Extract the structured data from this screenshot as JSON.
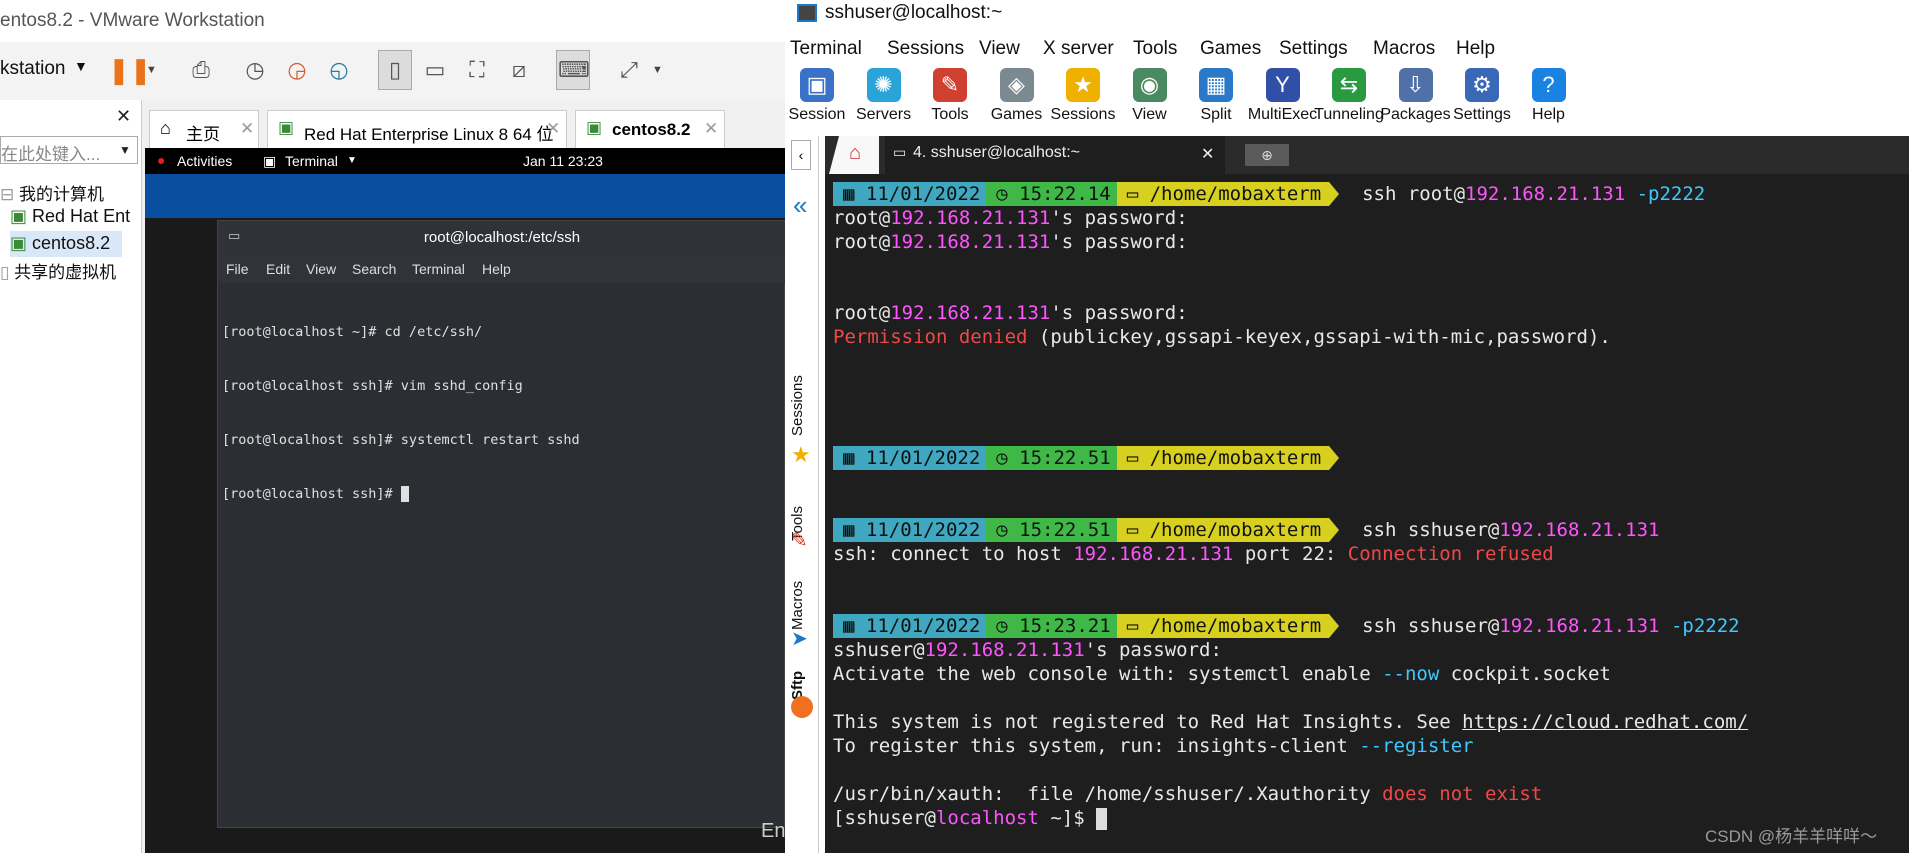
{
  "vmware": {
    "title": "entos8.2 - VMware Workstation",
    "toolbar_label": "kstation",
    "library": {
      "search_placeholder": "在此处键入...",
      "items": [
        "我的计算机",
        "Red Hat Ent",
        "centos8.2",
        "共享的虚拟机"
      ]
    },
    "tabs": [
      "主页",
      "Red Hat Enterprise Linux 8 64 位",
      "centos8.2"
    ],
    "gnome": {
      "activities": "Activities",
      "app": "Terminal",
      "clock": "Jan 11  23:23"
    },
    "guest_terminal": {
      "title": "root@localhost:/etc/ssh",
      "menu": [
        "File",
        "Edit",
        "View",
        "Search",
        "Terminal",
        "Help"
      ],
      "lines": [
        "[root@localhost ~]# cd /etc/ssh/",
        "[root@localhost ssh]# vim sshd_config",
        "[root@localhost ssh]# systemctl restart sshd",
        "[root@localhost ssh]# "
      ]
    },
    "corner_text": "En"
  },
  "mobaxterm": {
    "title": "sshuser@localhost:~",
    "menu": [
      "Terminal",
      "Sessions",
      "View",
      "X server",
      "Tools",
      "Games",
      "Settings",
      "Macros",
      "Help"
    ],
    "tools": [
      {
        "label": "Session",
        "icon": "session-icon",
        "color": "#3a72c8"
      },
      {
        "label": "Servers",
        "icon": "servers-icon",
        "color": "#2aa4d8"
      },
      {
        "label": "Tools",
        "icon": "tools-icon",
        "color": "#d04030"
      },
      {
        "label": "Games",
        "icon": "games-icon",
        "color": "#7a8a90"
      },
      {
        "label": "Sessions",
        "icon": "star-icon",
        "color": "#f0b000"
      },
      {
        "label": "View",
        "icon": "view-icon",
        "color": "#4a8a60"
      },
      {
        "label": "Split",
        "icon": "split-icon",
        "color": "#2a78c8"
      },
      {
        "label": "MultiExec",
        "icon": "multiexec-icon",
        "color": "#3050a8"
      },
      {
        "label": "Tunneling",
        "icon": "tunneling-icon",
        "color": "#2a9a40"
      },
      {
        "label": "Packages",
        "icon": "packages-icon",
        "color": "#5070a8"
      },
      {
        "label": "Settings",
        "icon": "settings-icon",
        "color": "#3a68b8"
      },
      {
        "label": "Help",
        "icon": "help-icon",
        "color": "#1a82e0"
      }
    ],
    "side_tabs": [
      "Sessions",
      "Tools",
      "Macros",
      "Sftp"
    ],
    "term_tab": "4. sshuser@localhost:~",
    "prompts": [
      {
        "date": "11/01/2022",
        "time": "15:22.14",
        "path": "/home/mobaxterm"
      },
      {
        "date": "11/01/2022",
        "time": "15:22.51",
        "path": "/home/mobaxterm"
      },
      {
        "date": "11/01/2022",
        "time": "15:22.51",
        "path": "/home/mobaxterm"
      },
      {
        "date": "11/01/2022",
        "time": "15:23.21",
        "path": "/home/mobaxterm"
      }
    ],
    "cmd1": {
      "a": "ssh root@",
      "ip": "192.168.21.131",
      "b": " -p2222"
    },
    "pw": {
      "user": "root@",
      "ip": "192.168.21.131",
      "rest": "'s password:"
    },
    "denied": {
      "red": "Permission denied",
      "rest": " (publickey,gssapi-keyex,gssapi-with-mic,password)."
    },
    "cmd3": {
      "a": "ssh sshuser@",
      "ip": "192.168.21.131"
    },
    "refused": {
      "a": "ssh: connect to host ",
      "ip": "192.168.21.131",
      "b": " port 22: ",
      "red": "Connection refused"
    },
    "cmd4": {
      "a": "ssh sshuser@",
      "ip": "192.168.21.131",
      "b": " -p2222"
    },
    "pw2": {
      "user": "sshuser@",
      "ip": "192.168.21.131",
      "rest": "'s password:"
    },
    "cockpit": {
      "a": "Activate the web console with: systemctl enable ",
      "opt": "--now",
      "b": " cockpit.socket"
    },
    "insights1": {
      "a": "This system is not registered to Red Hat Insights. See ",
      "url": "https://cloud.redhat.com/"
    },
    "insights2": {
      "a": "To register this system, run: insights-client ",
      "opt": "--register"
    },
    "xauth": {
      "a": "/usr/bin/xauth:  file /home/sshuser/.Xauthority ",
      "red": "does not exist"
    },
    "final": {
      "a": "[sshuser@",
      "host": "localhost",
      "b": " ~]$ "
    }
  },
  "watermark": "CSDN @杨羊羊咩咩～"
}
